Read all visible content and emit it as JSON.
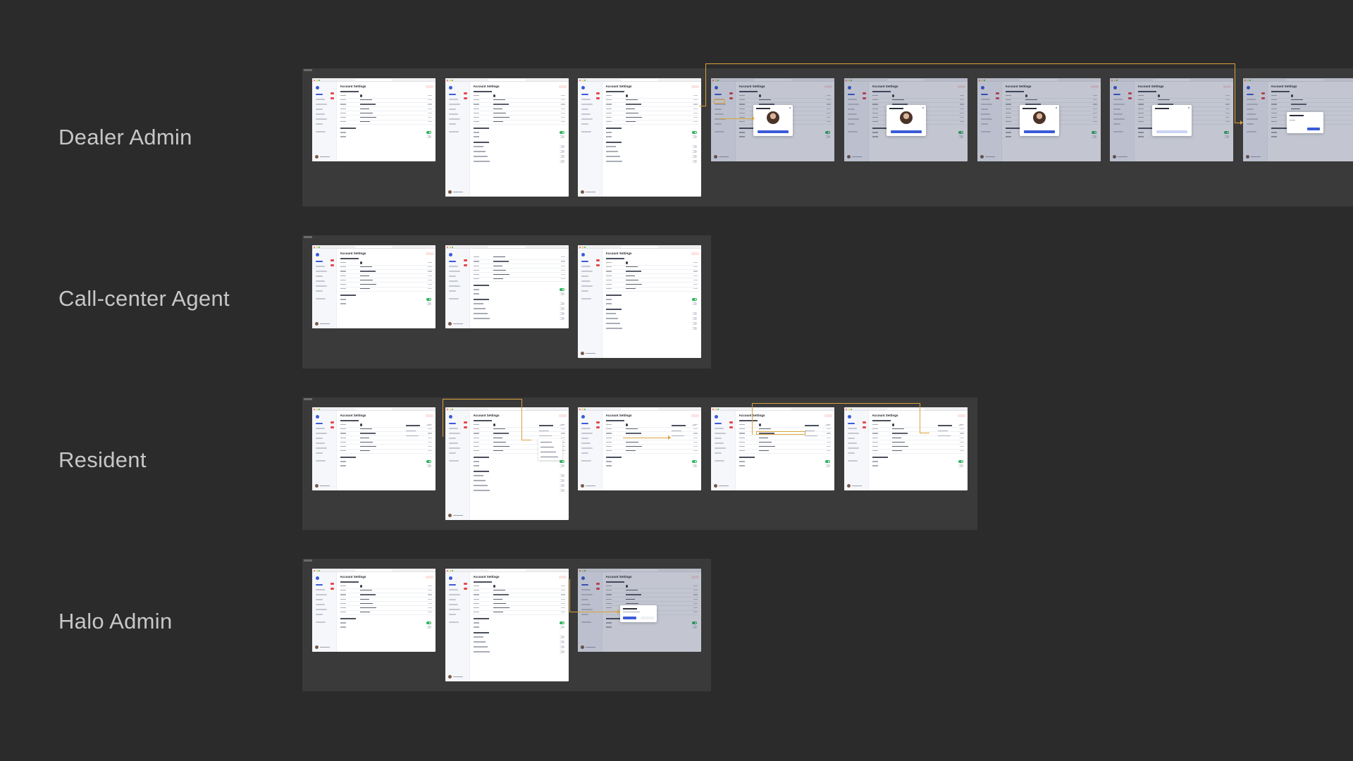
{
  "rows": [
    {
      "label": "Dealer Admin"
    },
    {
      "label": "Call-center Agent"
    },
    {
      "label": "Resident"
    },
    {
      "label": "Halo Admin"
    }
  ],
  "screen": {
    "title": "Account Settings"
  },
  "colors": {
    "background": "#2b2b2b",
    "section": "#3a3a3a",
    "connector": "#d9a23a",
    "accent": "#3a5bd9",
    "toggle_on": "#2fb45e"
  }
}
